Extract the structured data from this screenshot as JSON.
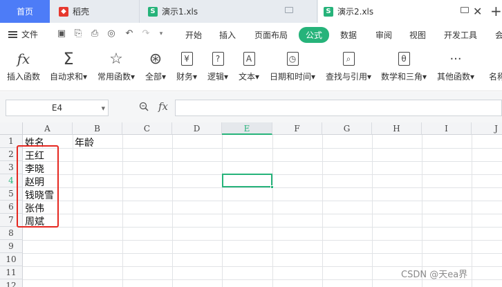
{
  "tabs": {
    "home": "首页",
    "daoke": "稻壳",
    "file1": "演示1.xls",
    "file2": "演示2.xls"
  },
  "menu": {
    "file": "文件",
    "tabs": [
      "开始",
      "插入",
      "页面布局",
      "公式",
      "数据",
      "审阅",
      "视图",
      "开发工具",
      "会"
    ]
  },
  "ribbon": [
    {
      "label": "插入函数",
      "icon": "fx-icon"
    },
    {
      "label": "自动求和",
      "icon": "sigma-icon",
      "dropdown": true
    },
    {
      "label": "常用函数",
      "icon": "star-icon",
      "dropdown": true
    },
    {
      "label": "全部",
      "icon": "asterisk-icon",
      "dropdown": true
    },
    {
      "label": "财务",
      "icon": "yen-icon",
      "dropdown": true
    },
    {
      "label": "逻辑",
      "icon": "question-icon",
      "dropdown": true
    },
    {
      "label": "文本",
      "icon": "text-a-icon",
      "dropdown": true
    },
    {
      "label": "日期和时间",
      "icon": "clock-icon",
      "dropdown": true
    },
    {
      "label": "查找与引用",
      "icon": "magnifier-icon",
      "dropdown": true
    },
    {
      "label": "数学和三角",
      "icon": "theta-icon",
      "dropdown": true
    },
    {
      "label": "其他函数",
      "icon": "more-dots-icon",
      "dropdown": true
    },
    {
      "label": "名称",
      "icon": "name-icon"
    }
  ],
  "formula_bar": {
    "name_box": "E4",
    "fx": "fx",
    "formula": ""
  },
  "sheet": {
    "columns": [
      "A",
      "B",
      "C",
      "D",
      "E",
      "F",
      "G",
      "H",
      "I",
      "J"
    ],
    "selected_column": "E",
    "rows": [
      "1",
      "2",
      "3",
      "4",
      "5",
      "6",
      "7",
      "8",
      "9",
      "10",
      "11",
      "12"
    ],
    "selected_row": "4",
    "cells": {
      "A1": "姓名",
      "B1": "年龄",
      "A2": "王红",
      "A3": "李晓",
      "A4": "赵明",
      "A5": "钱晓雪",
      "A6": "张伟",
      "A7": "周斌"
    }
  },
  "colors": {
    "accent_green": "#26b37a",
    "home_tab_blue": "#4d7cf7",
    "highlight_red": "#e5261f"
  },
  "watermark": "CSDN @天ea界"
}
